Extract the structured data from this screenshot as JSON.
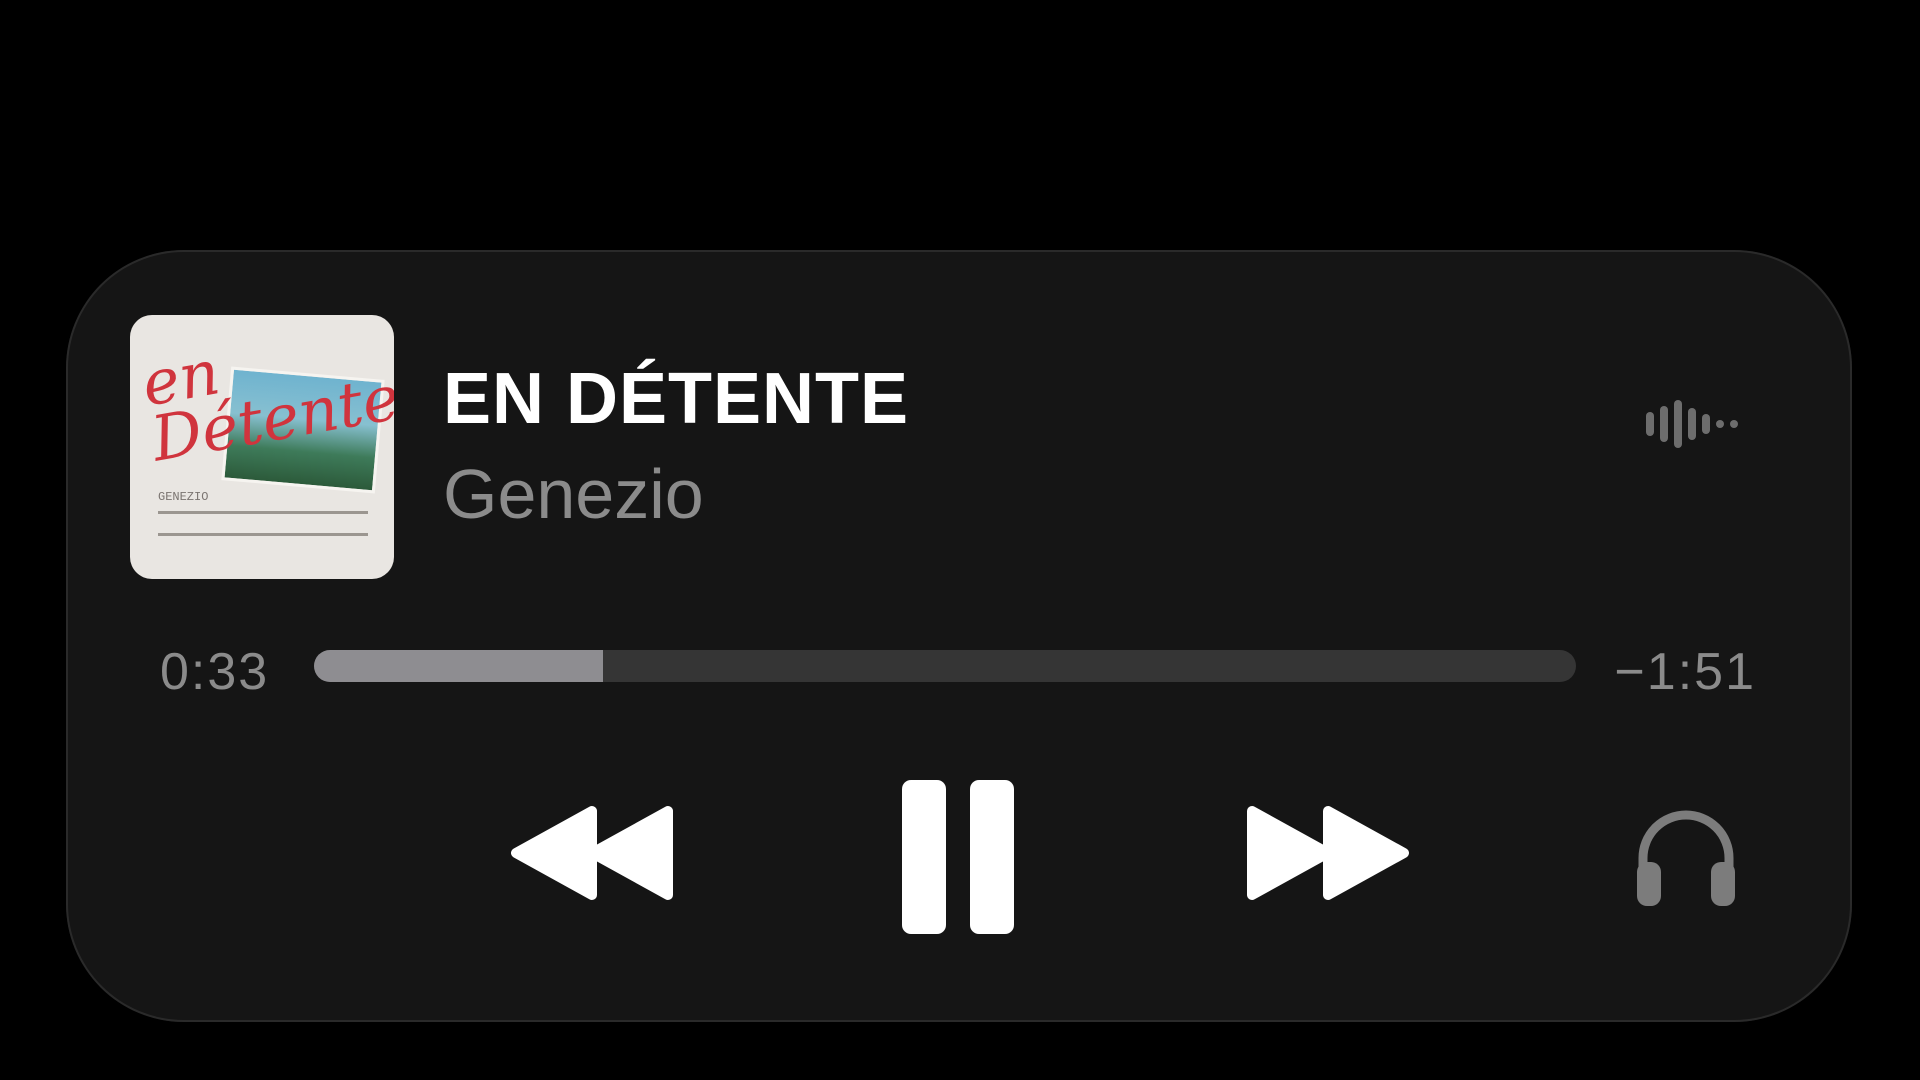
{
  "now_playing": {
    "title": "EN DÉTENTE",
    "artist": "Genezio",
    "artwork": {
      "script_text": "en Détente",
      "small_text": "GENEZIO"
    }
  },
  "progress": {
    "elapsed": "0:33",
    "remaining": "−1:51",
    "fraction": 0.229
  },
  "icons": {
    "waveform": "waveform-icon",
    "rewind": "backward-icon",
    "pause": "pause-icon",
    "forward": "forward-icon",
    "output": "headphones-icon"
  },
  "colors": {
    "background": "#000000",
    "card": "#151515",
    "primary_text": "#ffffff",
    "secondary_text": "#8b8b8b",
    "progress_fill": "#8e8d91",
    "progress_track": "#353535"
  }
}
